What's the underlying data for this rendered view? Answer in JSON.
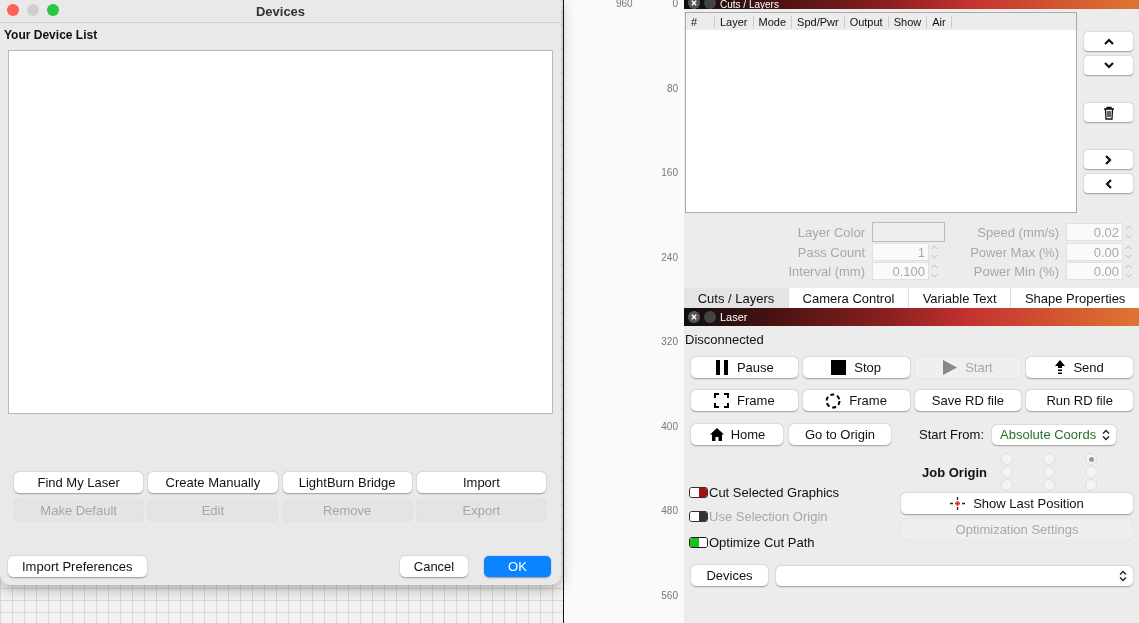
{
  "dialog": {
    "title": "Devices",
    "list_label": "Your Device List",
    "action_buttons": [
      {
        "label": "Find My Laser",
        "disabled": false
      },
      {
        "label": "Create Manually",
        "disabled": false
      },
      {
        "label": "LightBurn Bridge",
        "disabled": false
      },
      {
        "label": "Import",
        "disabled": false
      },
      {
        "label": "Make Default",
        "disabled": true
      },
      {
        "label": "Edit",
        "disabled": true
      },
      {
        "label": "Remove",
        "disabled": true
      },
      {
        "label": "Export",
        "disabled": true
      }
    ],
    "import_preferences": "Import Preferences",
    "cancel": "Cancel",
    "ok": "OK"
  },
  "ruler": {
    "top_label": "960",
    "side_labels": [
      "0",
      "80",
      "160",
      "240",
      "320",
      "400",
      "480",
      "560"
    ]
  },
  "cuts_layers": {
    "title": "Cuts / Layers",
    "columns": [
      "#",
      "Layer",
      "Mode",
      "Spd/Pwr",
      "Output",
      "Show",
      "Air"
    ],
    "side_button_groups": [
      [
        {
          "kind": "up"
        },
        {
          "kind": "down"
        }
      ],
      [
        {
          "kind": "delete"
        }
      ],
      [
        {
          "kind": "right"
        },
        {
          "kind": "left"
        }
      ]
    ],
    "fields": [
      {
        "label": "Layer Color",
        "kind": "color",
        "disabled": true
      },
      {
        "label": "Speed (mm/s)",
        "kind": "spin",
        "value": "0.02",
        "disabled": true
      },
      {
        "label": "Pass Count",
        "kind": "spin",
        "value": "1",
        "disabled": true
      },
      {
        "label": "Power Max (%)",
        "kind": "spin",
        "value": "0.00",
        "disabled": true
      },
      {
        "label": "Interval (mm)",
        "kind": "spin",
        "value": "0.100",
        "disabled": true
      },
      {
        "label": "Power Min (%)",
        "kind": "spin",
        "value": "0.00",
        "disabled": true
      }
    ],
    "tabs": [
      {
        "label": "Cuts / Layers",
        "selected": true
      },
      {
        "label": "Camera Control",
        "selected": false
      },
      {
        "label": "Variable Text",
        "selected": false
      },
      {
        "label": "Shape Properties",
        "selected": false
      }
    ]
  },
  "laser": {
    "title": "Laser",
    "status": "Disconnected",
    "buttons": [
      {
        "label": "Pause",
        "kind": "pause",
        "disabled": false
      },
      {
        "label": "Stop",
        "kind": "stop",
        "disabled": false
      },
      {
        "label": "Start",
        "kind": "play",
        "disabled": true
      },
      {
        "label": "Send",
        "kind": "send",
        "disabled": false
      },
      {
        "label": "Frame",
        "kind": "frame-square",
        "disabled": false
      },
      {
        "label": "Frame",
        "kind": "frame-circle",
        "disabled": false
      },
      {
        "label": "Save RD file",
        "kind": "none",
        "disabled": false
      },
      {
        "label": "Run RD file",
        "kind": "none",
        "disabled": false
      }
    ],
    "home_buttons": [
      {
        "label": "Home",
        "kind": "home"
      },
      {
        "label": "Go to Origin",
        "kind": "none"
      }
    ],
    "start_from": {
      "label": "Start From:",
      "value": "Absolute Coords"
    },
    "job_origin": {
      "label": "Job Origin",
      "options": [
        {
          "selected": false
        },
        {
          "selected": false
        },
        {
          "selected": true
        },
        {
          "selected": false
        },
        {
          "selected": false
        },
        {
          "selected": false
        },
        {
          "selected": false
        },
        {
          "selected": false
        },
        {
          "selected": false
        }
      ]
    },
    "toggles": [
      {
        "label": "Cut Selected Graphics",
        "on": false,
        "disabled": false
      },
      {
        "label": "Use Selection Origin",
        "on": false,
        "disabled": true
      },
      {
        "label": "Optimize Cut Path",
        "on": true,
        "disabled": false
      }
    ],
    "show_last_position": "Show Last Position",
    "optimization_settings": {
      "label": "Optimization Settings",
      "disabled": true
    },
    "devices_button": "Devices"
  }
}
